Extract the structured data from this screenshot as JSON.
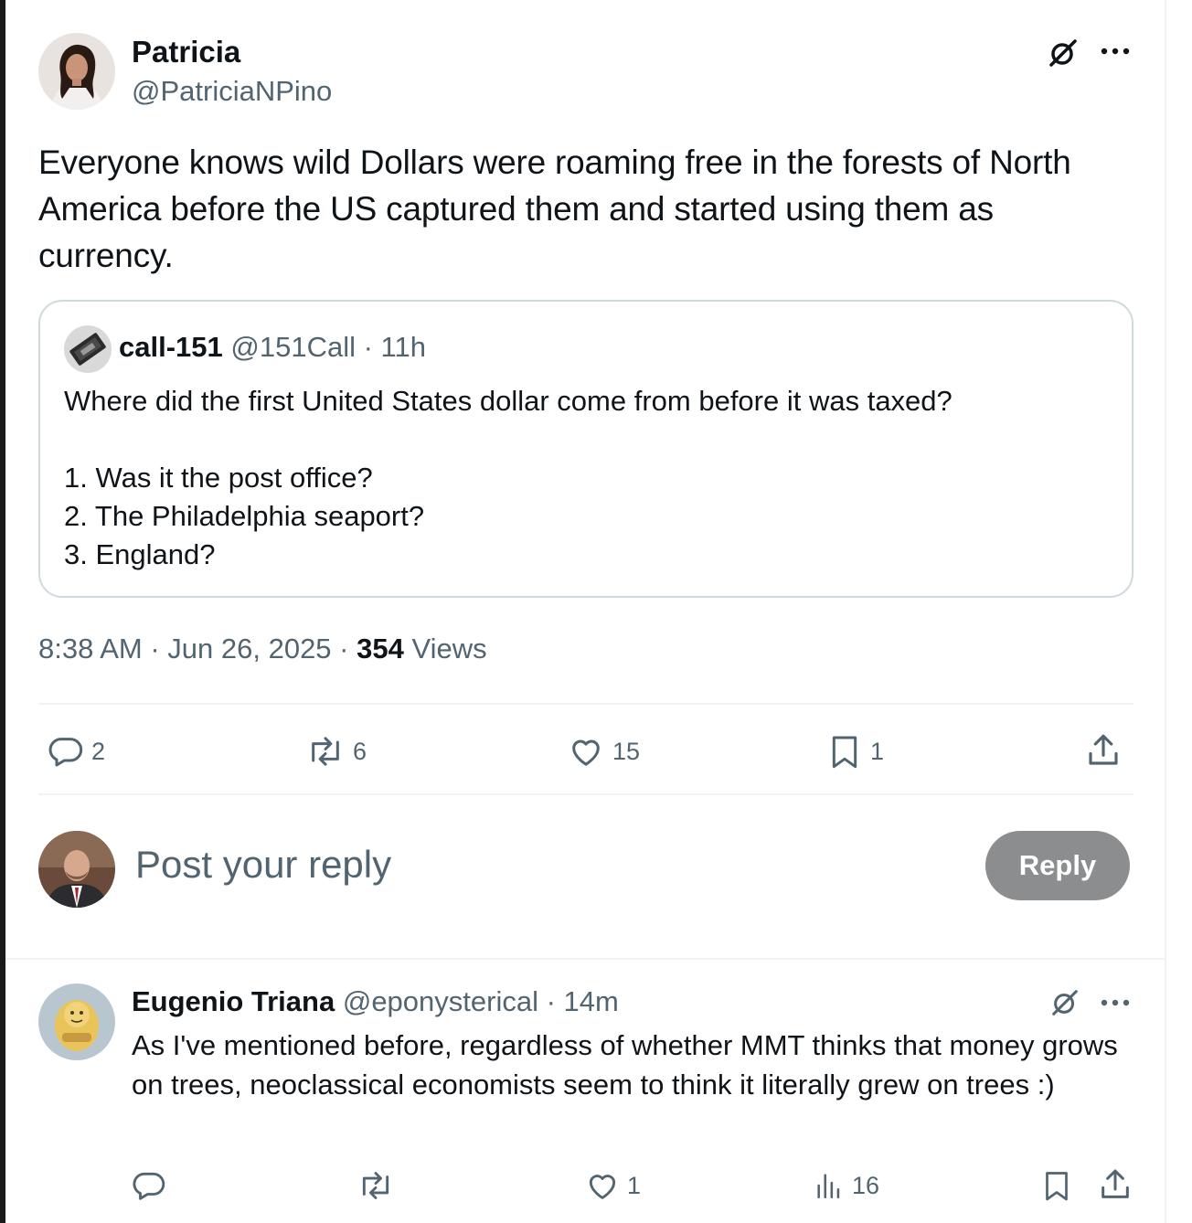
{
  "main_post": {
    "display_name": "Patricia",
    "handle": "@PatriciaNPino",
    "text": "Everyone knows wild Dollars were roaming free in the forests of North America before the US captured them and started using them as currency.",
    "timestamp": "8:38 AM · Jun 26, 2025 ·",
    "views_count": "354",
    "views_label": "Views",
    "actions": {
      "replies": "2",
      "reposts": "6",
      "likes": "15",
      "bookmarks": "1"
    }
  },
  "quoted_post": {
    "display_name": "call-151",
    "handle_time": "@151Call · 11h",
    "text": "Where did the first United States dollar come from before it was taxed?",
    "list": [
      "1. Was it the post office?",
      "2. The Philadelphia seaport?",
      "3. England?"
    ]
  },
  "composer": {
    "placeholder": "Post your reply",
    "reply_button": "Reply"
  },
  "reply": {
    "display_name": "Eugenio Triana",
    "handle_time": "@eponysterical · 14m",
    "text": "As I've mentioned before, regardless of whether MMT thinks that money grows on trees, neoclassical economists seem to think it literally grew on trees :)",
    "actions": {
      "replies": "",
      "reposts": "",
      "likes": "1",
      "views": "16"
    }
  },
  "icons": {
    "grok": "grok-icon",
    "more": "more-icon",
    "reply": "reply-icon",
    "repost": "repost-icon",
    "like": "heart-icon",
    "bookmark": "bookmark-icon",
    "share": "share-icon",
    "views": "views-icon"
  },
  "colors": {
    "text_primary": "#0f1419",
    "text_secondary": "#536471",
    "border": "#cfd9de",
    "reply_button_bg": "#8b8d8f"
  }
}
